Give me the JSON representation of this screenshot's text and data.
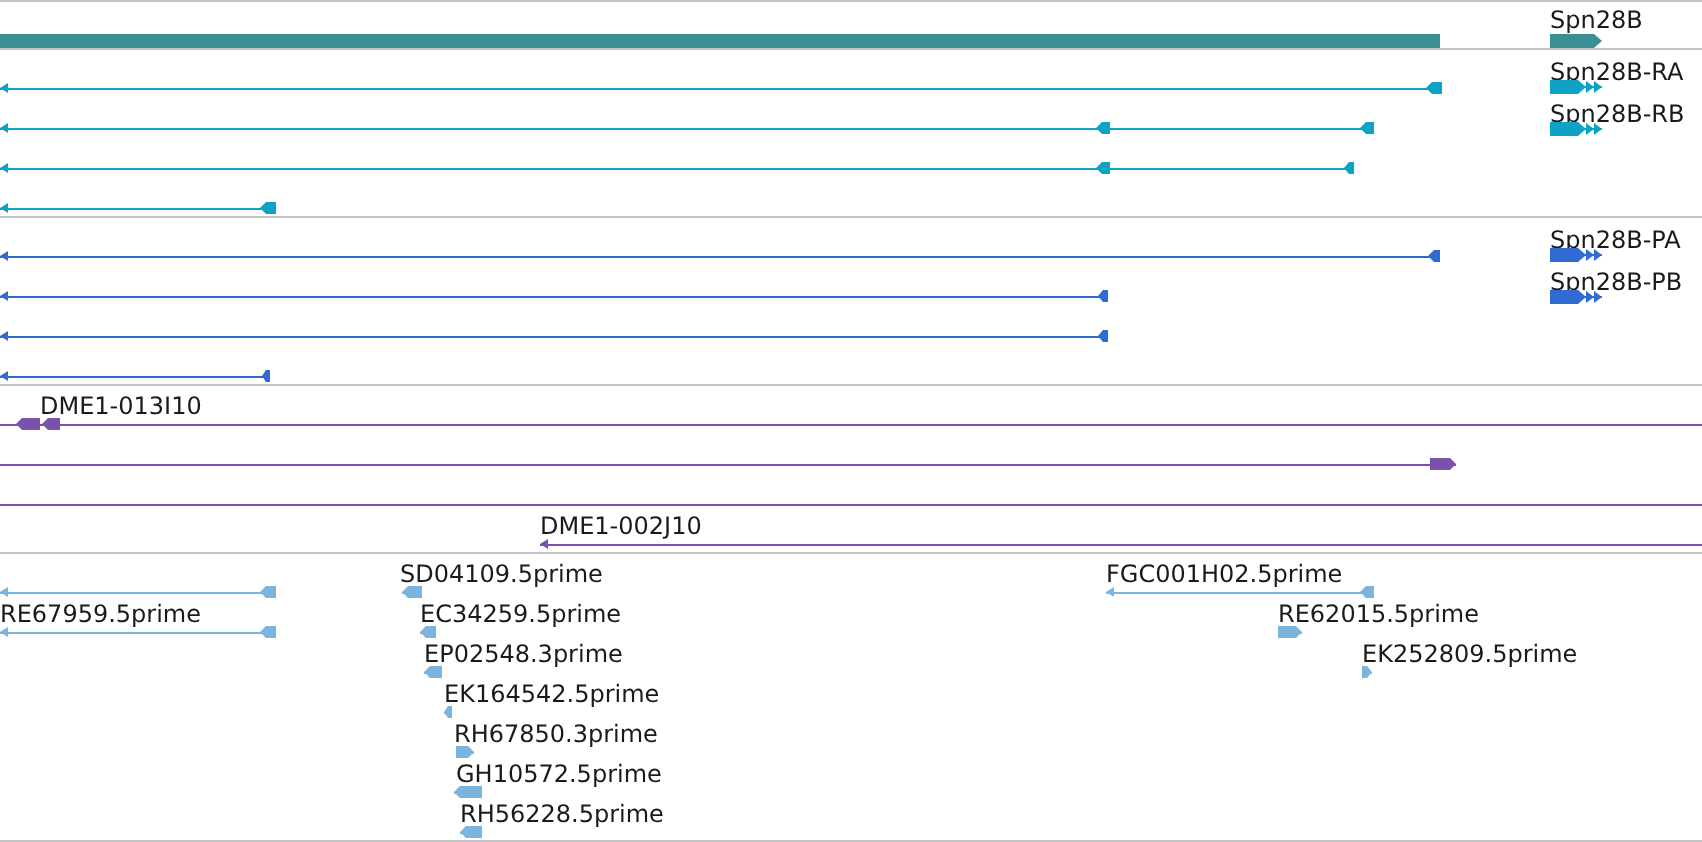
{
  "tracks": [
    {
      "kind": "gene",
      "legend": [
        {
          "label": "Spn28B"
        }
      ]
    },
    {
      "kind": "transcript",
      "features": [
        {
          "reverse": true
        },
        {
          "reverse": true
        },
        {
          "reverse": true
        },
        {
          "reverse": true
        }
      ],
      "legend": [
        {
          "label": "Spn28B-RA"
        },
        {
          "label": "Spn28B-RB"
        }
      ]
    },
    {
      "kind": "protein",
      "features": [
        {
          "reverse": true
        },
        {
          "reverse": true
        },
        {
          "reverse": true
        },
        {
          "reverse": true
        }
      ],
      "legend": [
        {
          "label": "Spn28B-PA"
        },
        {
          "label": "Spn28B-PB"
        }
      ]
    },
    {
      "kind": "clone",
      "features": [
        {
          "kind": "arrow",
          "label": "DME1-013I10",
          "reverse": true
        },
        {
          "kind": "arrow",
          "reverse": false
        },
        {
          "kind": "line"
        },
        {
          "kind": "arrow",
          "label": "DME1-002J10",
          "reverse": true
        }
      ]
    },
    {
      "kind": "est",
      "features": [
        {
          "reverse": true
        },
        {
          "label": "SD04109.5prime",
          "reverse": true
        },
        {
          "label": "FGC001H02.5prime",
          "reverse": true
        },
        {
          "label": "RE67959.5prime",
          "reverse": true
        },
        {
          "label": "EC34259.5prime",
          "reverse": true
        },
        {
          "label": "RE62015.5prime",
          "reverse": false
        },
        {
          "label": "EP02548.3prime",
          "reverse": true
        },
        {
          "label": "EK252809.5prime",
          "reverse": false
        },
        {
          "label": "EK164542.5prime",
          "reverse": true
        },
        {
          "label": "RH67850.3prime",
          "reverse": false
        },
        {
          "label": "GH10572.5prime",
          "reverse": true
        },
        {
          "label": "RH56228.5prime",
          "reverse": true
        }
      ]
    }
  ]
}
